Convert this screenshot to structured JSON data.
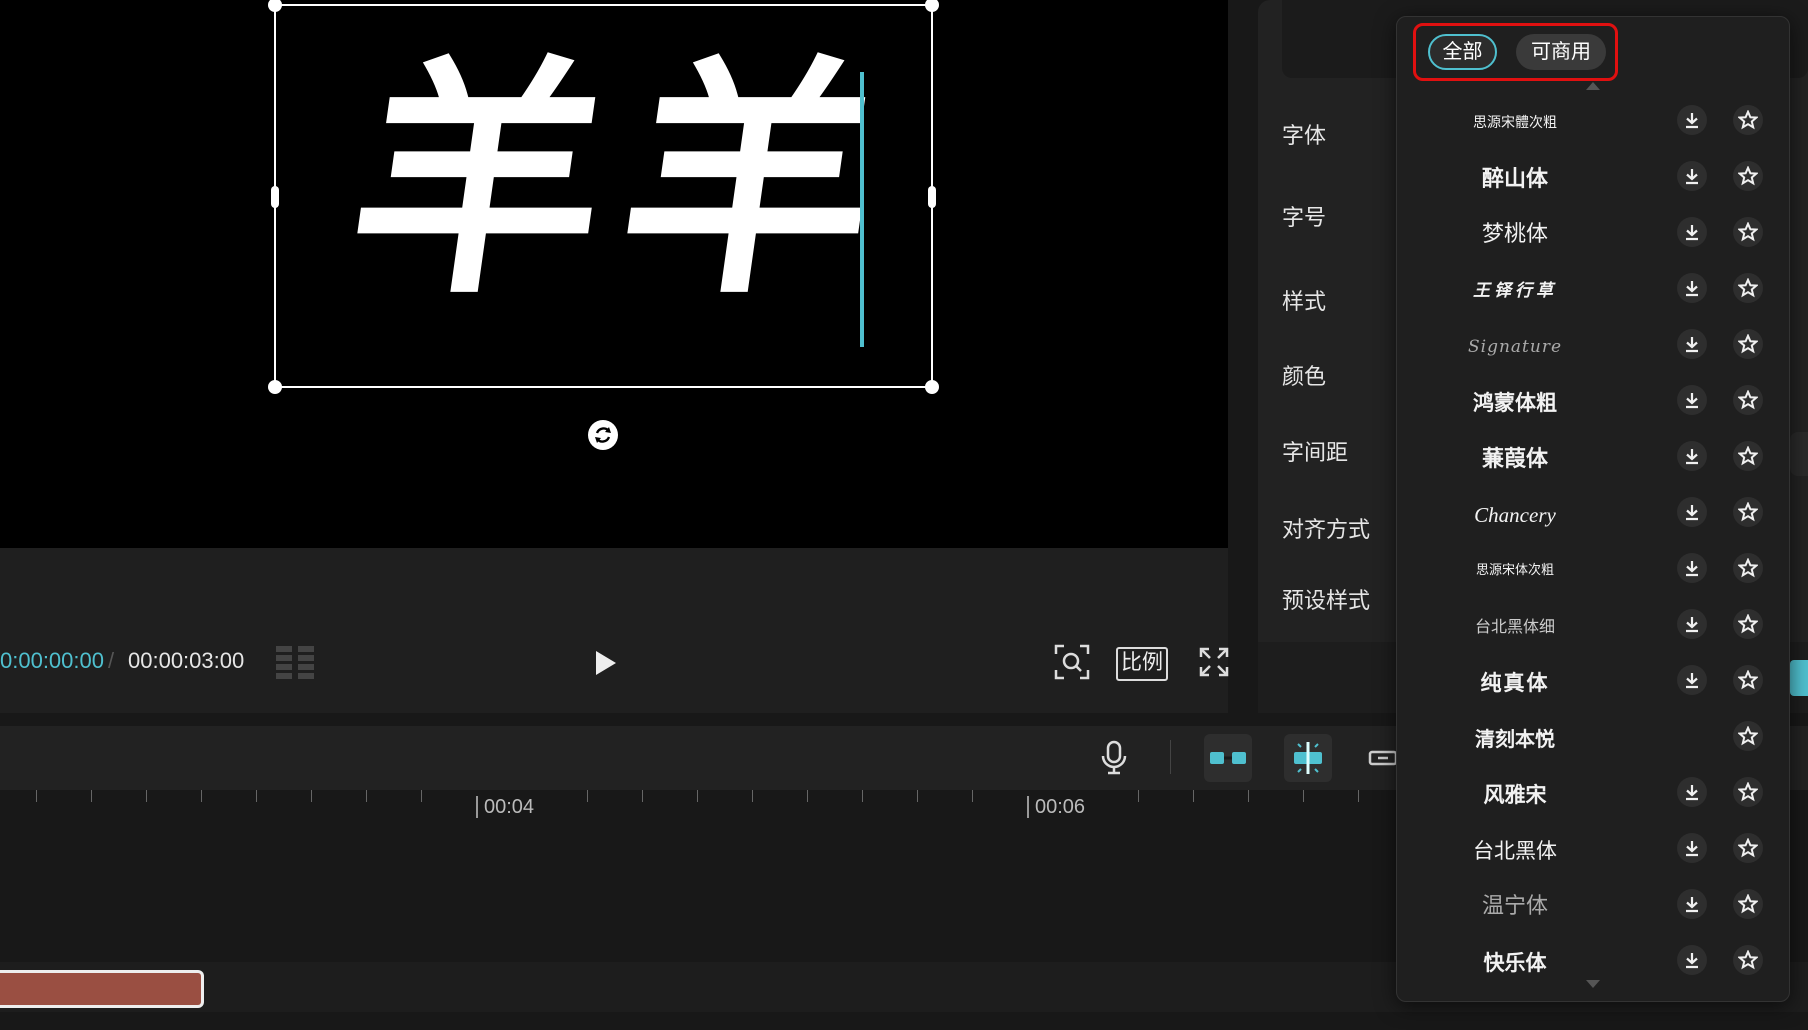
{
  "preview": {
    "text_content": "羊羊",
    "time_current": "0:00:00:00",
    "time_separator": "/",
    "time_total": "00:00:03:00",
    "ratio_label": "比例"
  },
  "properties": {
    "labels": [
      "字体",
      "字号",
      "样式",
      "颜色",
      "字间距",
      "对齐方式",
      "预设样式"
    ]
  },
  "timeline": {
    "ruler_labels": [
      "00:04",
      "00:06"
    ]
  },
  "font_dropdown": {
    "filters": {
      "all": "全部",
      "commercial": "可商用"
    },
    "fonts": [
      {
        "name": "思源宋體次粗",
        "downloadable": true
      },
      {
        "name": "醉山体",
        "downloadable": true
      },
      {
        "name": "梦桃体",
        "downloadable": true
      },
      {
        "name": "王铎行草",
        "downloadable": true
      },
      {
        "name": "Signature",
        "downloadable": true
      },
      {
        "name": "鸿蒙体粗",
        "downloadable": true
      },
      {
        "name": "蒹葭体",
        "downloadable": true
      },
      {
        "name": "Chancery",
        "downloadable": true
      },
      {
        "name": "思源宋体次粗",
        "downloadable": true
      },
      {
        "name": "台北黑体细",
        "downloadable": true
      },
      {
        "name": "纯真体",
        "downloadable": true
      },
      {
        "name": "清刻本悦",
        "downloadable": false
      },
      {
        "name": "风雅宋",
        "downloadable": true
      },
      {
        "name": "台北黑体",
        "downloadable": true
      },
      {
        "name": "温宁体",
        "downloadable": true
      },
      {
        "name": "快乐体",
        "downloadable": true
      }
    ]
  },
  "colors": {
    "accent": "#4fc0cf",
    "highlight": "#e01010",
    "clip": "#9a4f42"
  }
}
